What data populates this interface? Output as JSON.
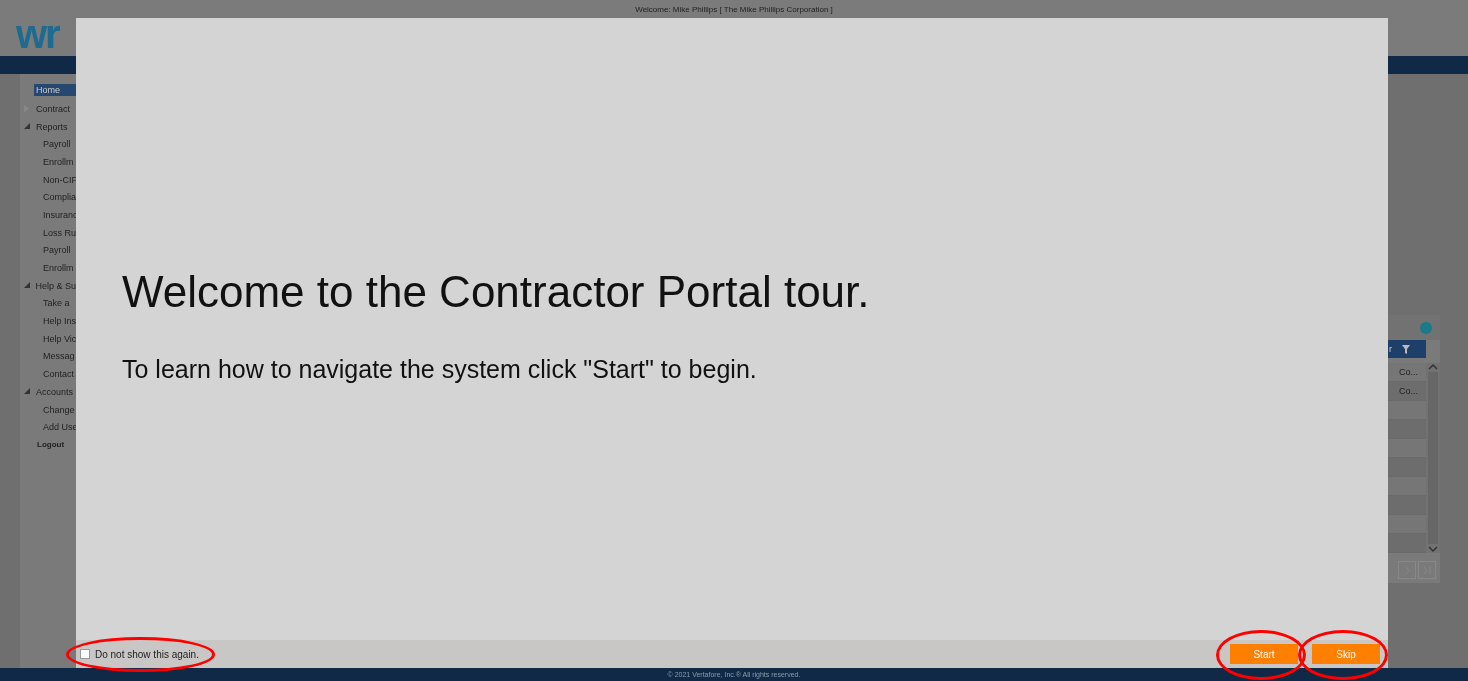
{
  "header": {
    "logo": "wr",
    "welcome": "Welcome: Mike Phillips [ The Mike Phillips Corporation ]"
  },
  "sidebar": {
    "items": [
      {
        "label": "Home",
        "kind": "link",
        "selected": true
      },
      {
        "label": "Contract",
        "kind": "section",
        "expanded": false,
        "selected": false
      },
      {
        "label": "Reports",
        "kind": "section",
        "expanded": true,
        "selected": false,
        "children": [
          {
            "label": "Payroll",
            "selected": false
          },
          {
            "label": "Enrollm",
            "selected": false
          },
          {
            "label": "Non-CIF",
            "selected": false
          },
          {
            "label": "Complia",
            "selected": false
          },
          {
            "label": "Insuranc",
            "selected": false
          },
          {
            "label": "Loss Ru",
            "selected": false
          },
          {
            "label": "Payroll",
            "selected": false
          },
          {
            "label": "Enrollm",
            "selected": false
          }
        ]
      },
      {
        "label": "Help & Su",
        "kind": "section",
        "expanded": true,
        "selected": false,
        "children": [
          {
            "label": "Take a",
            "selected": false
          },
          {
            "label": "Help Ins",
            "selected": false
          },
          {
            "label": "Help Vic",
            "selected": false
          },
          {
            "label": "Messag",
            "selected": false
          },
          {
            "label": "Contact",
            "selected": false
          }
        ]
      },
      {
        "label": "Accounts",
        "kind": "section",
        "expanded": true,
        "selected": false,
        "children": [
          {
            "label": "Change",
            "selected": false
          },
          {
            "label": "Add Use",
            "selected": false
          }
        ]
      },
      {
        "label": "Logout",
        "kind": "action",
        "selected": false
      }
    ]
  },
  "grid": {
    "column_1": "r",
    "rows": [
      {
        "column_1": "Co..."
      },
      {
        "column_1": "Co..."
      },
      {},
      {},
      {},
      {},
      {},
      {},
      {},
      {}
    ]
  },
  "footer": {
    "copyright": "© 2021 Vertafore, Inc.® All rights reserved."
  },
  "tour_dialog": {
    "title": "Welcome to the Contractor Portal tour.",
    "message": "To learn how to navigate the system click \"Start\" to begin.",
    "dont_show_again": {
      "label": "Do not show this again.",
      "checked": false,
      "circled": true
    },
    "buttons": [
      {
        "label": "Start",
        "circled": true
      },
      {
        "label": "Skip",
        "circled": true
      }
    ]
  }
}
